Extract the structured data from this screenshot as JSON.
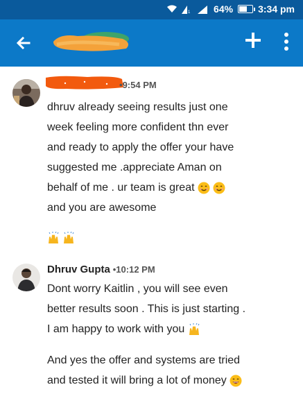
{
  "status": {
    "battery": "64%",
    "battery_level": 0.64,
    "time": "3:34 pm"
  },
  "appbar": {
    "back_icon": "back-arrow-icon",
    "add_icon": "plus-icon",
    "more_icon": "more-vertical-icon",
    "brand_color": "#0c79c8",
    "status_color": "#0a5a9c"
  },
  "messages": [
    {
      "sender": "",
      "time": "9:54 PM",
      "lines": [
        "dhruv already seeing results just one",
        "week feeling more confident thn ever",
        "and ready to apply the offer your have",
        "suggested me .appreciate Aman on",
        "behalf of me . ur team is great",
        "and you are awesome"
      ]
    },
    {
      "sender": "Dhruv Gupta",
      "time": "10:12 PM",
      "lines": [
        "Dont worry Kaitlin , you will see even",
        "better results soon . This is just starting .",
        "I am happy to work with you"
      ],
      "lines2": [
        "And yes the offer and systems are tried",
        "and tested it will bring a lot of money"
      ]
    }
  ]
}
